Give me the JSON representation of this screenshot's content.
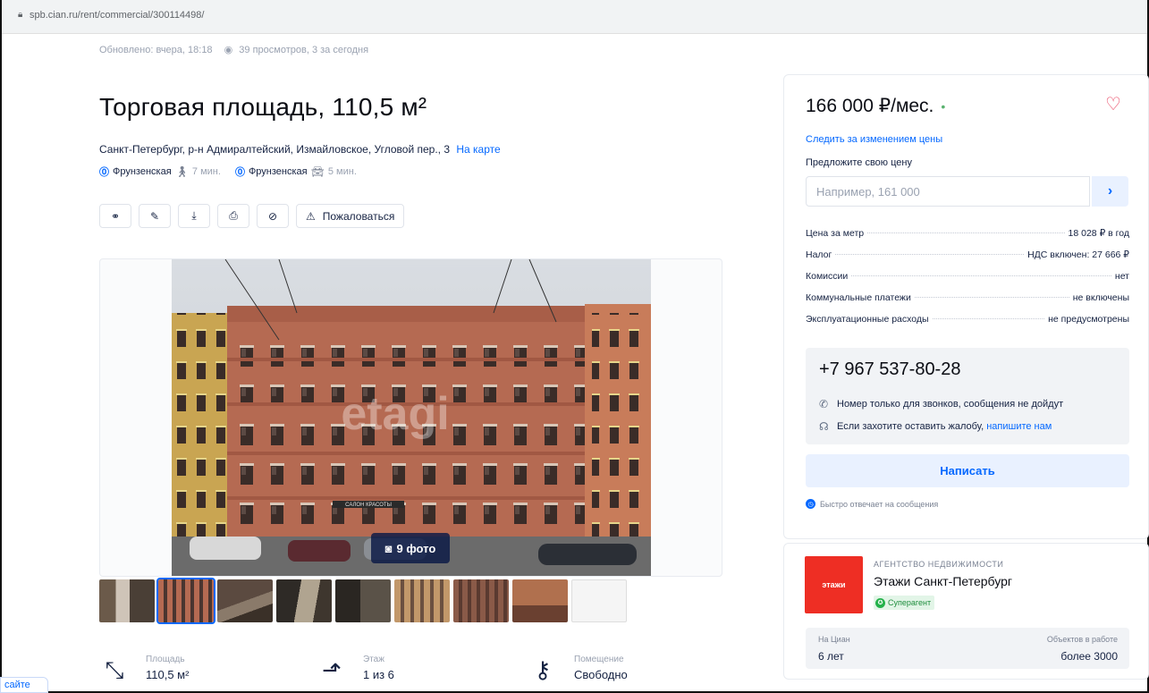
{
  "browser": {
    "url": "spb.cian.ru/rent/commercial/300114498/"
  },
  "meta": {
    "updated": "Обновлено: вчера, 18:18",
    "views": "39 просмотров, 3 за сегодня"
  },
  "title": "Торговая площадь, 110,5 м²",
  "address": {
    "text": "Санкт-Петербург, р-н Адмиралтейский, Измайловское, Угловой пер., 3",
    "map_link": "На карте"
  },
  "metro": [
    {
      "station": "Фрунзенская",
      "mode": "walk",
      "time": "7 мин."
    },
    {
      "station": "Фрунзенская",
      "mode": "car",
      "time": "5 мин."
    }
  ],
  "toolbar": {
    "complain_label": "Пожаловаться"
  },
  "gallery": {
    "photo_count": "9 фото",
    "watermark": "etagi",
    "sign": "САЛОН КРАСОТЫ"
  },
  "features": [
    {
      "label": "Площадь",
      "value": "110,5 м²"
    },
    {
      "label": "Этаж",
      "value": "1 из 6"
    },
    {
      "label": "Помещение",
      "value": "Свободно"
    }
  ],
  "site_badge": "сайте",
  "sidebar": {
    "price": "166 000 ₽/мес.",
    "watch_price": "Следить за изменением цены",
    "offer_label": "Предложите свою цену",
    "offer_placeholder": "Например, 161 000",
    "params": [
      {
        "label": "Цена за метр",
        "value": "18 028 ₽ в год"
      },
      {
        "label": "Налог",
        "value": "НДС включен: 27 666 ₽"
      },
      {
        "label": "Комиссии",
        "value": "нет"
      },
      {
        "label": "Коммунальные платежи",
        "value": "не включены"
      },
      {
        "label": "Эксплуатационные расходы",
        "value": "не предусмотрены"
      }
    ],
    "phone": "+7 967 537-80-28",
    "calls_only": "Номер только для звонков, сообщения не дойдут",
    "complaint_text": "Если захотите оставить жалобу,",
    "complaint_link": "напишите нам",
    "write_button": "Написать",
    "fast_reply": "Быстро отвечает на сообщения"
  },
  "agency": {
    "logo_text": "этажи",
    "type": "АГЕНТСТВО НЕДВИЖИМОСТИ",
    "name": "Этажи Санкт-Петербург",
    "badge": "Суперагент",
    "stats": [
      {
        "label": "На Циан",
        "value": "6 лет"
      },
      {
        "label": "Объектов в работе",
        "value": "более 3000"
      }
    ]
  },
  "colors": {
    "accent": "#0468ff",
    "heart": "#e83a58",
    "logo": "#ee2e24",
    "superagent": "#24b24b"
  }
}
